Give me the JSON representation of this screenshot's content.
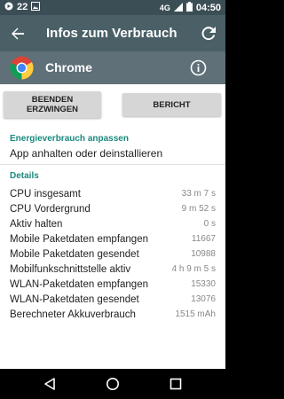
{
  "status_bar": {
    "notification_count": "22",
    "network_type": "4G",
    "time": "04:50"
  },
  "toolbar": {
    "title": "Infos zum Verbrauch"
  },
  "app": {
    "name": "Chrome"
  },
  "buttons": {
    "force_stop": "BEENDEN\nERZWINGEN",
    "report": "BERICHT"
  },
  "energy": {
    "heading": "Energieverbrauch anpassen",
    "item": "App anhalten oder deinstallieren"
  },
  "details": {
    "heading": "Details",
    "rows": [
      {
        "label": "CPU insgesamt",
        "value": "33 m 7 s"
      },
      {
        "label": "CPU Vordergrund",
        "value": "9 m 52 s"
      },
      {
        "label": "Aktiv halten",
        "value": "0 s"
      },
      {
        "label": "Mobile Paketdaten empfangen",
        "value": "11667"
      },
      {
        "label": "Mobile Paketdaten gesendet",
        "value": "10988"
      },
      {
        "label": "Mobilfunkschnittstelle aktiv",
        "value": "4 h 9 m 5 s"
      },
      {
        "label": "WLAN-Paketdaten empfangen",
        "value": "15330"
      },
      {
        "label": "WLAN-Paketdaten gesendet",
        "value": "13076"
      },
      {
        "label": "Berechneter Akkuverbrauch",
        "value": "1515 mAh"
      }
    ]
  },
  "colors": {
    "status_bar": "#3c4e55",
    "toolbar": "#4a5f66",
    "app_header": "#607078",
    "accent": "#1a8a7e"
  }
}
